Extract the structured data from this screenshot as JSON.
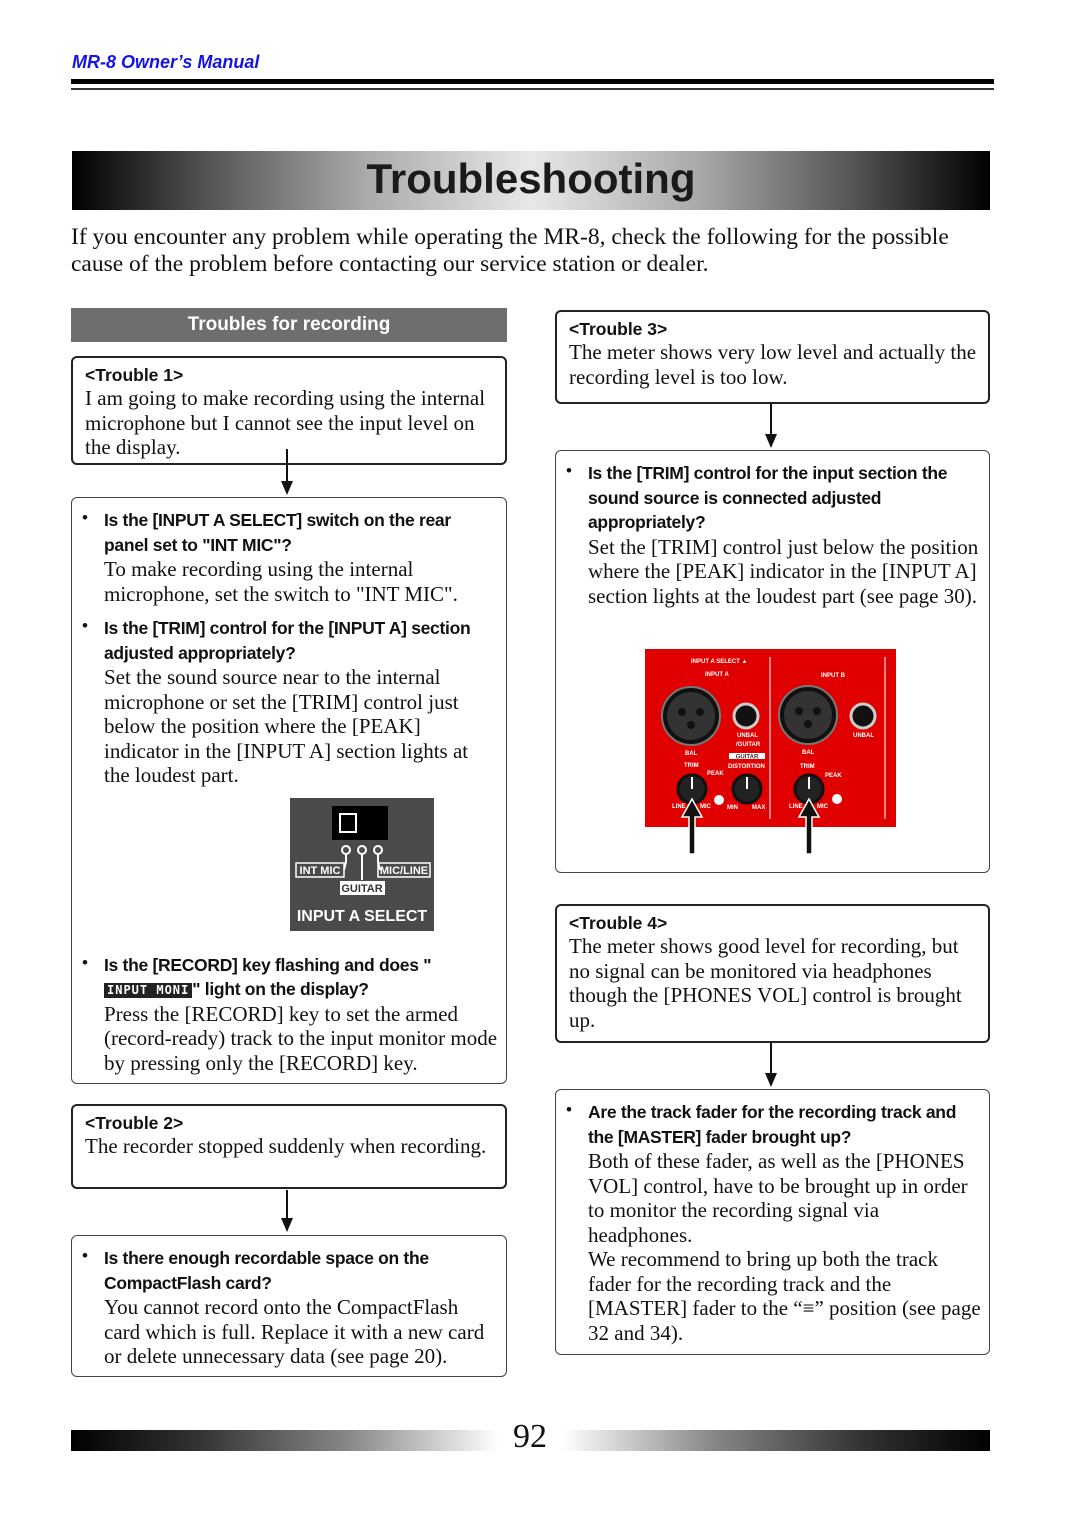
{
  "header": {
    "running_title": "MR-8 Owner’s Manual"
  },
  "page_title": "Troubleshooting",
  "intro": "If you encounter any problem while operating the MR-8, check the following for the possible cause of the problem before contacting our service station or dealer.",
  "section_heading": "Troubles for recording",
  "trouble1": {
    "title": "<Trouble 1>",
    "text": "I am going to make recording using the internal microphone but I cannot see the input level on the display.",
    "checks": [
      {
        "question": "Is the [INPUT A SELECT] switch on the rear panel set to \"INT MIC\"?",
        "answer": "To make recording using the internal microphone, set the switch to \"INT MIC\"."
      },
      {
        "question": "Is the [TRIM] control for the [INPUT A] section adjusted appropriately?",
        "answer": "Set the sound source near to the internal microphone or  set the [TRIM] control just below the position where the [PEAK] indicator in the [INPUT A] section lights at the loudest part."
      },
      {
        "question_pre": "Is the [RECORD] key flashing and does \"",
        "question_lcd": "INPUT MONI",
        "question_post": "\" light on the display?",
        "answer": "Press the [RECORD] key to set the armed (record-ready) track to the input monitor mode by pressing only the [RECORD] key."
      }
    ],
    "switch_diagram": {
      "int_mic": "INT MIC",
      "guitar": "GUITAR",
      "mic_line": "MIC/LINE",
      "label": "INPUT A SELECT"
    }
  },
  "trouble2": {
    "title": "<Trouble 2>",
    "text": "The recorder stopped suddenly when recording.",
    "checks": [
      {
        "question": "Is there enough recordable space on the CompactFlash card?",
        "answer": "You cannot record onto the CompactFlash card which is full. Replace it with a new card or delete unnecessary data (see page 20)."
      }
    ]
  },
  "trouble3": {
    "title": "<Trouble 3>",
    "text": "The meter shows very low level and actually the recording level is too low.",
    "checks": [
      {
        "question": "Is the [TRIM] control for the input section the sound source is connected adjusted appropriately?",
        "answer": "Set the [TRIM] control just below the position where the [PEAK] indicator in the [INPUT A] section lights at the loudest part (see page 30)."
      }
    ],
    "panel": {
      "color": "#e00000",
      "input_a_select": "INPUT A SELECT ▲",
      "input_a": "INPUT A",
      "input_b": "INPUT B",
      "unbal_guitar_1": "UNBAL",
      "unbal_guitar_2": "/GUITAR",
      "unbal": "UNBAL",
      "bal": "BAL",
      "guitar": "GUITAR",
      "distortion": "DISTORTION",
      "trim": "TRIM",
      "peak": "PEAK",
      "line": "LINE",
      "mic": "MIC",
      "min": "MIN",
      "max": "MAX"
    }
  },
  "trouble4": {
    "title": "<Trouble 4>",
    "text": "The meter shows good level for recording, but no signal can be monitored via headphones though the [PHONES VOL] control is brought up.",
    "checks": [
      {
        "question": "Are the track fader for the recording track and the [MASTER] fader brought up?",
        "answer": "Both of these fader, as well as the [PHONES VOL] control, have to be brought up in order to monitor the recording signal via headphones.",
        "answer2": "We recommend to bring up both the track fader for the recording track and the [MASTER] fader to the “≡” position (see page 32 and 34)."
      }
    ]
  },
  "footer": {
    "page_number": "92"
  }
}
